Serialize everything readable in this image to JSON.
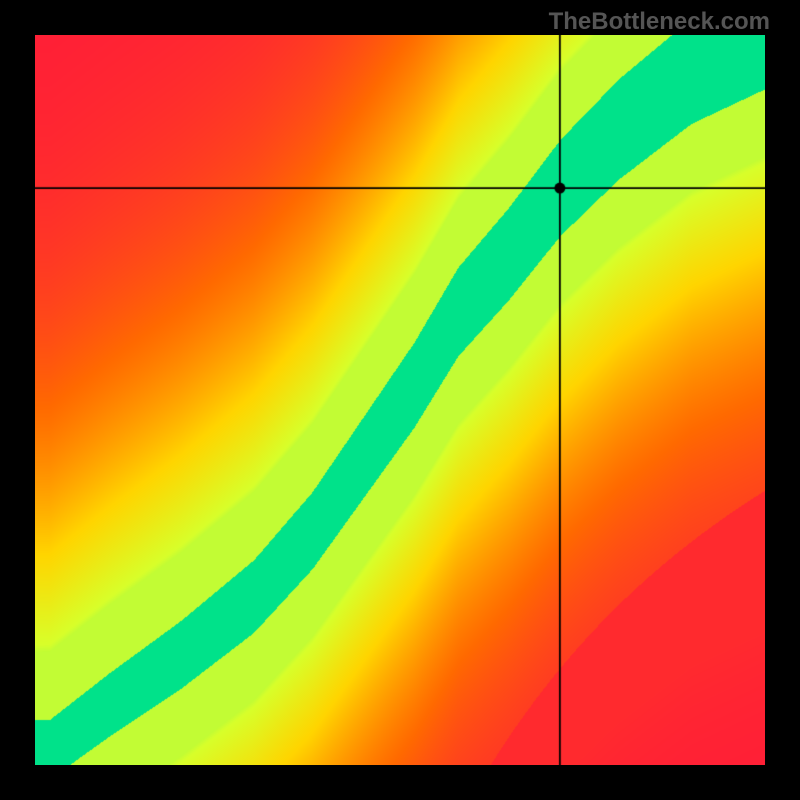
{
  "watermark": "TheBottleneck.com",
  "chart_data": {
    "type": "heatmap",
    "title": "",
    "xlabel": "",
    "ylabel": "",
    "xlim": [
      0,
      1
    ],
    "ylim": [
      0,
      1
    ],
    "crosshair": {
      "x": 0.72,
      "y": 0.79
    },
    "optimal_curve": {
      "description": "Green ridge running from bottom-left to top-right with S-curve shape",
      "points": [
        {
          "x": 0.02,
          "y": 0.02
        },
        {
          "x": 0.1,
          "y": 0.08
        },
        {
          "x": 0.2,
          "y": 0.15
        },
        {
          "x": 0.3,
          "y": 0.23
        },
        {
          "x": 0.38,
          "y": 0.32
        },
        {
          "x": 0.45,
          "y": 0.42
        },
        {
          "x": 0.52,
          "y": 0.52
        },
        {
          "x": 0.58,
          "y": 0.62
        },
        {
          "x": 0.65,
          "y": 0.7
        },
        {
          "x": 0.72,
          "y": 0.79
        },
        {
          "x": 0.8,
          "y": 0.87
        },
        {
          "x": 0.9,
          "y": 0.95
        },
        {
          "x": 1.0,
          "y": 1.0
        }
      ]
    },
    "color_scale": {
      "low": "#ff1a3a",
      "mid_low": "#ff6a00",
      "mid": "#ffd500",
      "mid_high": "#d8ff2a",
      "high": "#00e28a"
    }
  }
}
